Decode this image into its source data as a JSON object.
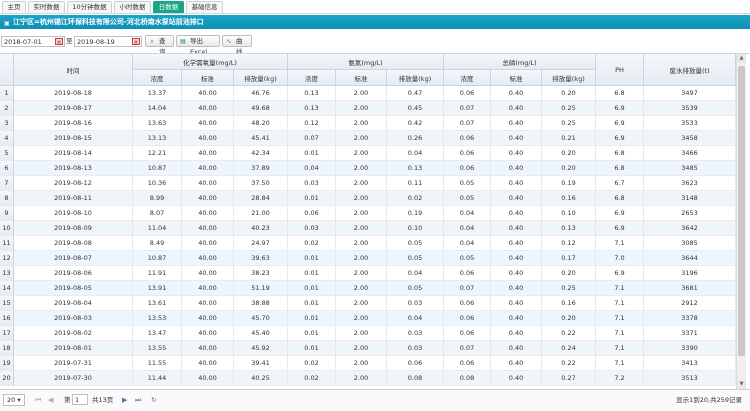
{
  "tabs": [
    {
      "label": "主页",
      "active": false
    },
    {
      "label": "实时数据",
      "active": false
    },
    {
      "label": "10分钟数据",
      "active": false
    },
    {
      "label": "小时数据",
      "active": false
    },
    {
      "label": "日数据",
      "active": true
    },
    {
      "label": "基础信息",
      "active": false
    }
  ],
  "title": "江宁区=杭州锡江环保科技有限公司-河北桥南水泵站前池排口",
  "toolbar": {
    "start_date": "2018-07-01",
    "separator": "至",
    "end_date": "2019-08-19",
    "query_label": "查询",
    "export_label": "导出Excel",
    "curve_label": "曲线"
  },
  "headers": {
    "time": "时间",
    "cod": "化学需氧量(mg/L)",
    "nh3": "氨氮(mg/L)",
    "tp": "总磷(mg/L)",
    "ph": "PH",
    "flow": "废水排放量(t)",
    "sub": [
      "浓度",
      "标准",
      "排放量(kg)"
    ]
  },
  "rows": [
    [
      "1",
      "2019-08-18",
      "13.37",
      "40.00",
      "46.76",
      "0.13",
      "2.00",
      "0.47",
      "0.06",
      "0.40",
      "0.20",
      "6.8",
      "3497"
    ],
    [
      "2",
      "2019-08-17",
      "14.04",
      "40.00",
      "49.68",
      "0.13",
      "2.00",
      "0.45",
      "0.07",
      "0.40",
      "0.25",
      "6.9",
      "3539"
    ],
    [
      "3",
      "2019-08-16",
      "13.63",
      "40.00",
      "48.20",
      "0.12",
      "2.00",
      "0.42",
      "0.07",
      "0.40",
      "0.25",
      "6.9",
      "3533"
    ],
    [
      "4",
      "2019-08-15",
      "13.13",
      "40.00",
      "45.41",
      "0.07",
      "2.00",
      "0.26",
      "0.06",
      "0.40",
      "0.21",
      "6.9",
      "3458"
    ],
    [
      "5",
      "2019-08-14",
      "12.21",
      "40.00",
      "42.34",
      "0.01",
      "2.00",
      "0.04",
      "0.06",
      "0.40",
      "0.20",
      "6.8",
      "3466"
    ],
    [
      "6",
      "2019-08-13",
      "10.87",
      "40.00",
      "37.89",
      "0.04",
      "2.00",
      "0.13",
      "0.06",
      "0.40",
      "0.20",
      "6.8",
      "3485"
    ],
    [
      "7",
      "2019-08-12",
      "10.36",
      "40.00",
      "37.50",
      "0.03",
      "2.00",
      "0.11",
      "0.05",
      "0.40",
      "0.19",
      "6.7",
      "3623"
    ],
    [
      "8",
      "2019-08-11",
      "8.99",
      "40.00",
      "28.84",
      "0.01",
      "2.00",
      "0.02",
      "0.05",
      "0.40",
      "0.16",
      "6.8",
      "3148"
    ],
    [
      "9",
      "2019-08-10",
      "8.07",
      "40.00",
      "21.00",
      "0.06",
      "2.00",
      "0.19",
      "0.04",
      "0.40",
      "0.10",
      "6.9",
      "2653"
    ],
    [
      "10",
      "2019-08-09",
      "11.04",
      "40.00",
      "40.23",
      "0.03",
      "2.00",
      "0.10",
      "0.04",
      "0.40",
      "0.13",
      "6.9",
      "3642"
    ],
    [
      "11",
      "2019-08-08",
      "8.49",
      "40.00",
      "24.97",
      "0.02",
      "2.00",
      "0.05",
      "0.04",
      "0.40",
      "0.12",
      "7.1",
      "3085"
    ],
    [
      "12",
      "2019-08-07",
      "10.87",
      "40.00",
      "39.63",
      "0.01",
      "2.00",
      "0.05",
      "0.05",
      "0.40",
      "0.17",
      "7.0",
      "3644"
    ],
    [
      "13",
      "2019-08-06",
      "11.91",
      "40.00",
      "38.23",
      "0.01",
      "2.00",
      "0.04",
      "0.06",
      "0.40",
      "0.20",
      "6.9",
      "3196"
    ],
    [
      "14",
      "2019-08-05",
      "13.91",
      "40.00",
      "51.19",
      "0.01",
      "2.00",
      "0.05",
      "0.07",
      "0.40",
      "0.25",
      "7.1",
      "3681"
    ],
    [
      "15",
      "2019-08-04",
      "13.61",
      "40.00",
      "38.88",
      "0.01",
      "2.00",
      "0.03",
      "0.06",
      "0.40",
      "0.16",
      "7.1",
      "2912"
    ],
    [
      "16",
      "2019-08-03",
      "13.53",
      "40.00",
      "45.70",
      "0.01",
      "2.00",
      "0.04",
      "0.06",
      "0.40",
      "0.20",
      "7.1",
      "3378"
    ],
    [
      "17",
      "2019-08-02",
      "13.47",
      "40.00",
      "45.40",
      "0.01",
      "2.00",
      "0.03",
      "0.06",
      "0.40",
      "0.22",
      "7.1",
      "3371"
    ],
    [
      "18",
      "2019-08-01",
      "13.55",
      "40.00",
      "45.92",
      "0.01",
      "2.00",
      "0.03",
      "0.07",
      "0.40",
      "0.24",
      "7.1",
      "3390"
    ],
    [
      "19",
      "2019-07-31",
      "11.55",
      "40.00",
      "39.41",
      "0.02",
      "2.00",
      "0.06",
      "0.06",
      "0.40",
      "0.22",
      "7.1",
      "3413"
    ],
    [
      "20",
      "2019-07-30",
      "11.44",
      "40.00",
      "40.25",
      "0.02",
      "2.00",
      "0.08",
      "0.08",
      "0.40",
      "0.27",
      "7.2",
      "3513"
    ]
  ],
  "pager": {
    "page_size": "20",
    "page_prefix": "第",
    "current_page": "1",
    "page_suffix": "共13页",
    "info": "显示1到20,共259记录"
  },
  "colors": {
    "active_tab": "#18a689",
    "title_bar": "#1aa5c8",
    "alt_row": "#eef5fb"
  }
}
